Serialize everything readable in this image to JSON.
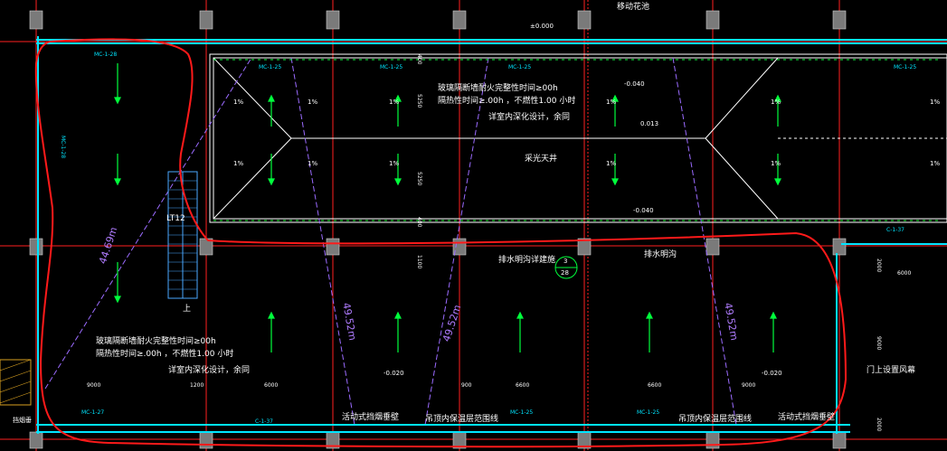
{
  "labels": {
    "elev_top": "±0.000",
    "movable_planter": "移动花池",
    "glass_wall_1": "玻璃隔断墙耐火完整性时间≥00h",
    "glass_wall_2": "隔热性时间≥.00h ，不燃性1.00 小时",
    "detail_ref": "详室内深化设计，余同",
    "skylight": "采光天井",
    "drain_ditch_detail": "排水明沟详建施",
    "drain_ditch": "排水明沟",
    "stair_id": "LT12",
    "stair_up": "上",
    "diag_left": "44.69m",
    "diag_c1": "49.52m",
    "diag_c2": "49.52m",
    "diag_c3": "49.52m",
    "glass_wall_b1": "玻璃隔断墙耐火完整性时间≥00h",
    "glass_wall_b2": "隔热性时间≥.00h ，不燃性1.00 小时",
    "detail_ref_b": "详室内深化设计，余同",
    "door_curtain": "门上设置风幕",
    "movable_smoke_1": "活动式挡烟垂壁",
    "ceiling_insulation_1": "吊顶内保温层范围线",
    "ceiling_insulation_2": "吊顶内保温层范围线",
    "movable_smoke_2": "活动式挡烟垂壁",
    "smoke_left": "挡烟垂",
    "elev_n040": "-0.040",
    "elev_013": "0.013",
    "elev_n040b": "-0.040",
    "elev_n020a": "-0.020",
    "elev_n020b": "-0.020",
    "section_num": "3",
    "section_sheet": "28"
  },
  "slopes": [
    "1%",
    "1%",
    "1%",
    "1%",
    "1%",
    "1%",
    "1%",
    "1%",
    "1%",
    "1%",
    "1%",
    "1%"
  ],
  "doors": {
    "mc128": "MC-1-28",
    "mc125": "MC-1-25",
    "mc127": "MC-1-27",
    "c137": "C-1-37",
    "mc128v": "MC-1-28"
  },
  "dims": {
    "d5250a": "5250",
    "d5250b": "5250",
    "d400a": "400",
    "d400b": "400",
    "d1100": "1100",
    "d9000a": "9000",
    "d9000b": "9000",
    "d1200": "1200",
    "d6000a": "6000",
    "d6000b": "6000",
    "d6600a": "6600",
    "d6600b": "6600",
    "d900": "900",
    "d2000a": "2000",
    "d2000b": "2000",
    "d9000v": "9000"
  },
  "colors": {
    "background": "#000000",
    "wall": "#00e5ff",
    "grid": "#ff2020",
    "annotation": "#ffffff",
    "markup": "#ff1a1a",
    "dimension": "#b07cff",
    "arrow": "#00ff3c"
  }
}
